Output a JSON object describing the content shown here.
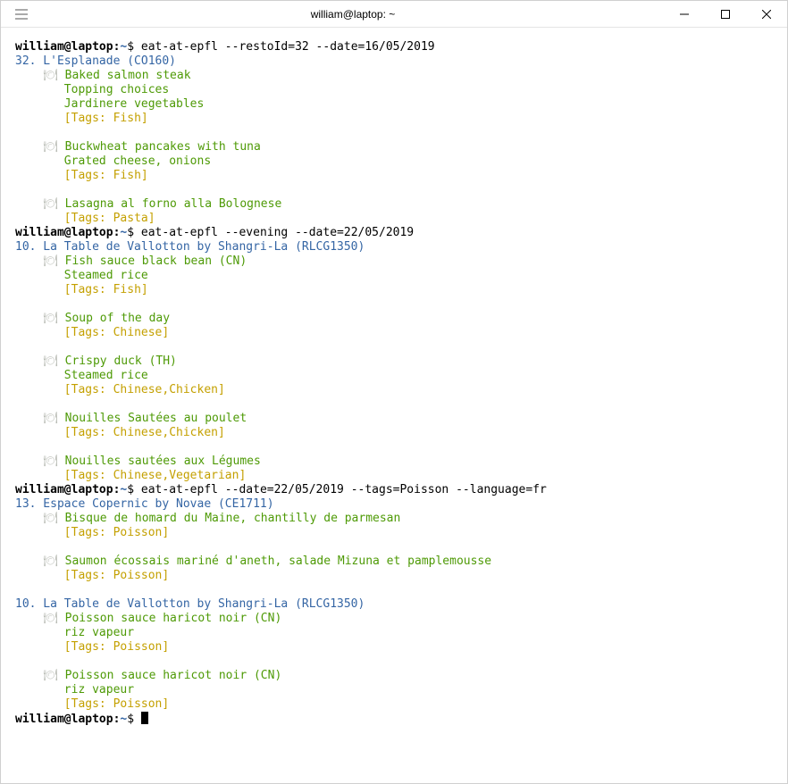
{
  "titlebar": {
    "title": "william@laptop: ~"
  },
  "prompt": {
    "user_host": "william@laptop",
    "path": "~",
    "symbol": "$"
  },
  "commands": {
    "c1": "eat-at-epfl --restoId=32 --date=16/05/2019",
    "c2": "eat-at-epfl --evening --date=22/05/2019",
    "c3": "eat-at-epfl --date=22/05/2019 --tags=Poisson --language=fr"
  },
  "sections": {
    "s1": {
      "header": "32. L'Esplanade (CO160)",
      "items": [
        {
          "lines": [
            "Baked salmon steak",
            "Topping choices",
            "Jardinere vegetables"
          ],
          "tags": "[Tags: Fish]"
        },
        {
          "lines": [
            "Buckwheat pancakes with tuna",
            "Grated cheese, onions"
          ],
          "tags": "[Tags: Fish]"
        },
        {
          "lines": [
            "Lasagna al forno alla Bolognese"
          ],
          "tags": "[Tags: Pasta]"
        }
      ]
    },
    "s2": {
      "header": "10. La Table de Vallotton by Shangri-La (RLCG1350)",
      "items": [
        {
          "lines": [
            "Fish sauce black bean (CN)",
            "Steamed rice"
          ],
          "tags": "[Tags: Fish]"
        },
        {
          "lines": [
            "Soup of the day"
          ],
          "tags": "[Tags: Chinese]"
        },
        {
          "lines": [
            "Crispy duck (TH)",
            "Steamed rice"
          ],
          "tags": "[Tags: Chinese,Chicken]"
        },
        {
          "lines": [
            "Nouilles Sautées au poulet"
          ],
          "tags": "[Tags: Chinese,Chicken]"
        },
        {
          "lines": [
            "Nouilles sautées aux Légumes"
          ],
          "tags": "[Tags: Chinese,Vegetarian]"
        }
      ]
    },
    "s3a": {
      "header": "13. Espace Copernic by Novae (CE1711)",
      "items": [
        {
          "lines": [
            "Bisque de homard du Maine, chantilly de parmesan"
          ],
          "tags": "[Tags: Poisson]"
        },
        {
          "lines": [
            "Saumon écossais mariné d'aneth, salade Mizuna et pamplemousse"
          ],
          "tags": "[Tags: Poisson]"
        }
      ]
    },
    "s3b": {
      "header": "10. La Table de Vallotton by Shangri-La (RLCG1350)",
      "items": [
        {
          "lines": [
            "Poisson sauce haricot noir (CN)",
            "riz vapeur"
          ],
          "tags": "[Tags: Poisson]"
        },
        {
          "lines": [
            "Poisson sauce haricot noir (CN)",
            "riz vapeur"
          ],
          "tags": "[Tags: Poisson]"
        }
      ]
    }
  },
  "icon_glyph": "🍽"
}
